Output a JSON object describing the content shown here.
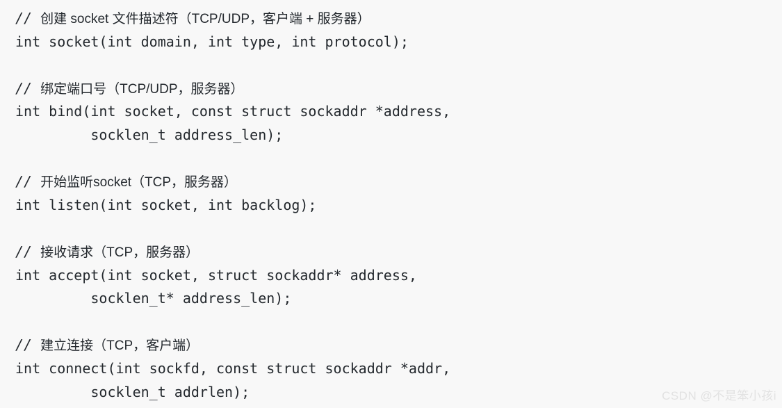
{
  "page": {
    "background_color": "#f8f8f8",
    "text_color": "#24292e",
    "kind": "code-snippet",
    "language": "c"
  },
  "code": {
    "lines": [
      {
        "type": "comment",
        "slashes": "// ",
        "text": "创建 socket 文件描述符（TCP/UDP，客户端 + 服务器）"
      },
      {
        "type": "code",
        "text": "int socket(int domain, int type, int protocol);"
      },
      {
        "type": "blank",
        "text": ""
      },
      {
        "type": "comment",
        "slashes": "// ",
        "text": "绑定端口号（TCP/UDP，服务器）"
      },
      {
        "type": "code",
        "text": "int bind(int socket, const struct sockaddr *address,"
      },
      {
        "type": "code",
        "text": "         socklen_t address_len);"
      },
      {
        "type": "blank",
        "text": ""
      },
      {
        "type": "comment",
        "slashes": "// ",
        "text": "开始监听socket（TCP，服务器）"
      },
      {
        "type": "code",
        "text": "int listen(int socket, int backlog);"
      },
      {
        "type": "blank",
        "text": ""
      },
      {
        "type": "comment",
        "slashes": "// ",
        "text": "接收请求（TCP，服务器）"
      },
      {
        "type": "code",
        "text": "int accept(int socket, struct sockaddr* address,"
      },
      {
        "type": "code",
        "text": "         socklen_t* address_len);"
      },
      {
        "type": "blank",
        "text": ""
      },
      {
        "type": "comment",
        "slashes": "// ",
        "text": "建立连接（TCP，客户端）"
      },
      {
        "type": "code",
        "text": "int connect(int sockfd, const struct sockaddr *addr,"
      },
      {
        "type": "code",
        "text": "         socklen_t addrlen);"
      }
    ]
  },
  "watermark": {
    "text": "CSDN @不是笨小孩i",
    "color": "#e2e2e2"
  }
}
